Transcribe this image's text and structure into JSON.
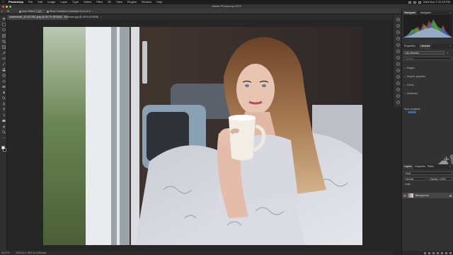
{
  "menubar": {
    "items": [
      "Photoshop",
      "File",
      "Edit",
      "Image",
      "Layer",
      "Type",
      "Select",
      "Filter",
      "3D",
      "View",
      "Plugins",
      "Window",
      "Help"
    ],
    "clock": "Wed Nov 2  12:34 PM"
  },
  "window": {
    "title": "Adobe Photoshop 2023"
  },
  "options": {
    "auto_select_label": "Auto-Select:",
    "auto_select_value": "Layer",
    "show_transform_label": "Show Transform Controls"
  },
  "tabs": [
    {
      "label": "Adobestock_421417891.jpeg @ 66.7% (RGB/8)",
      "active": true
    },
    {
      "label": "Bedroom.jpg @ 100% (RGB/8)",
      "active": false
    }
  ],
  "status": {
    "zoom": "66.67%",
    "info": "2400 px x 1602 px (300 ppi)"
  },
  "panels": {
    "top_tabs": [
      "Histogram",
      "Navigator"
    ],
    "mid_tabs": [
      "Properties",
      "Libraries"
    ],
    "library_dropdown": "My Libraries",
    "search_placeholder": "Search",
    "sections": [
      "Images",
      "Graphic graphics",
      "Colors",
      "Gradients"
    ],
    "status_label": "Sync progress",
    "layers_tabs": [
      "Layers",
      "Channels",
      "Paths"
    ],
    "layers_kind": "Kind",
    "layers_mode": "Normal",
    "layers_opacity": "Opacity: 100%",
    "layers_lock": "Lock:",
    "layer_name": "Background"
  },
  "colors": {
    "accent": "#2f6bb5",
    "close_light": "#ec5f57",
    "min_light": "#e0c24a",
    "max_light": "#61c454"
  }
}
